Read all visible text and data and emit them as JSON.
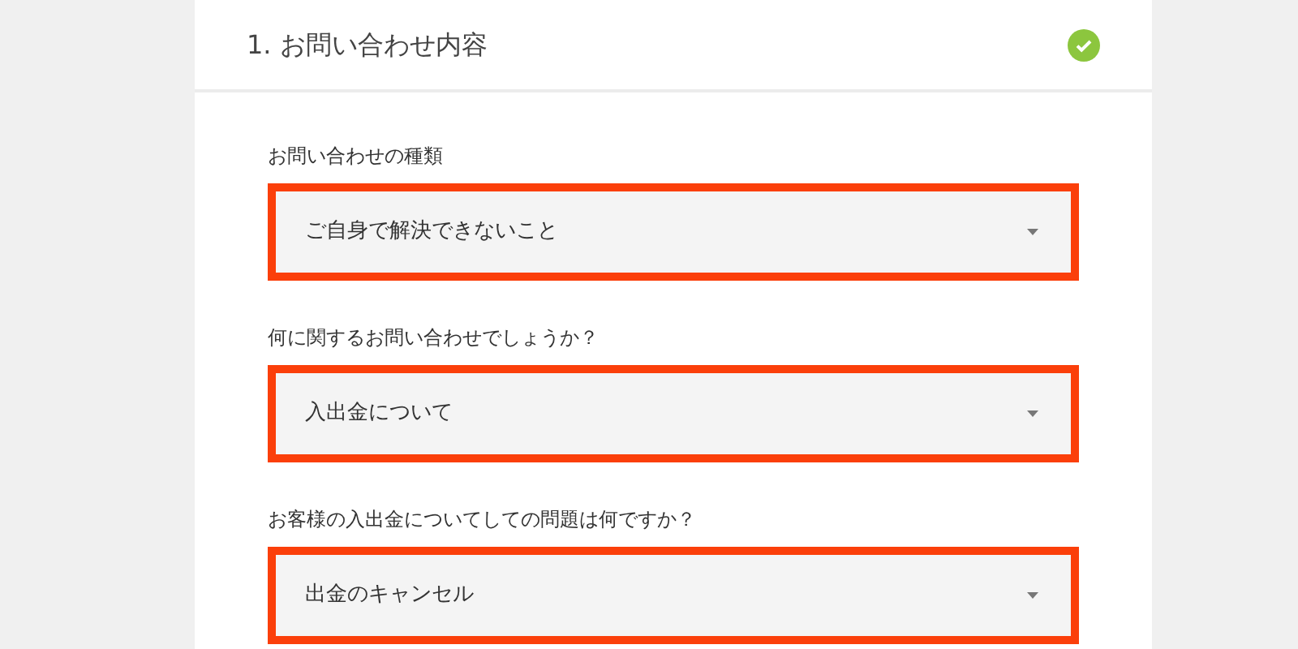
{
  "section": {
    "title": "1. お問い合わせ内容",
    "completed": true
  },
  "fields": [
    {
      "label": "お問い合わせの種類",
      "value": "ご自身で解決できないこと",
      "highlighted": true
    },
    {
      "label": "何に関するお問い合わせでしょうか？",
      "value": "入出金について",
      "highlighted": true
    },
    {
      "label": "お客様の入出金についてしての問題は何ですか？",
      "value": "出金のキャンセル",
      "highlighted": true
    }
  ]
}
